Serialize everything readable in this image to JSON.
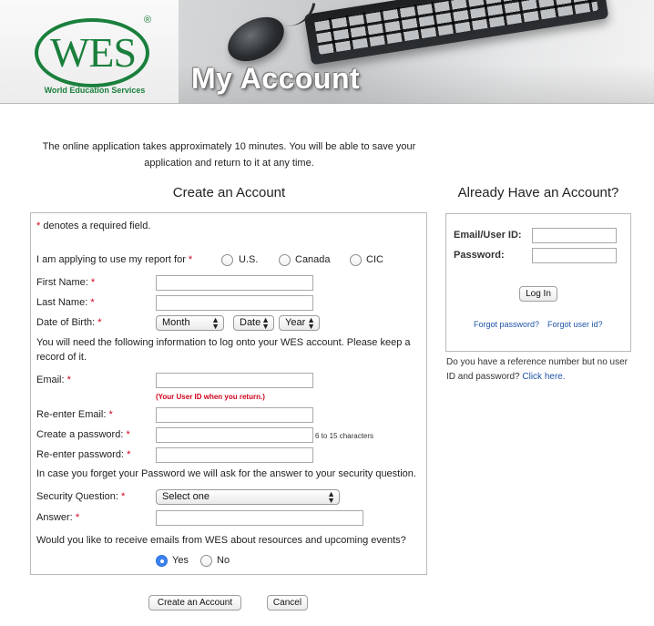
{
  "header": {
    "logo": {
      "mark": "WES",
      "registered": "®",
      "caption": "World Education Services"
    },
    "banner_title": "My Account"
  },
  "intro": {
    "line1": "The online application takes approximately 10 minutes. You will be able to save your",
    "line2": "application and return to it at any time."
  },
  "create_account": {
    "heading": "Create an Account",
    "required_note_star": "*",
    "required_note_text": " denotes a required field.",
    "report_for": {
      "label": "I am applying to use my report for",
      "options": [
        "U.S.",
        "Canada",
        "CIC"
      ],
      "selected": null
    },
    "first_name": {
      "label": "First Name:",
      "value": ""
    },
    "last_name": {
      "label": "Last Name:",
      "value": ""
    },
    "dob": {
      "label": "Date of Birth:",
      "month": "Month",
      "date": "Date",
      "year": "Year"
    },
    "logon_info_text": "You will need the following information to log onto your WES account. Please keep a record of it.",
    "email": {
      "label": "Email:",
      "value": "",
      "note": "(Your User ID when you return.)"
    },
    "reenter_email": {
      "label": "Re-enter Email:",
      "value": ""
    },
    "password": {
      "label": "Create a password:",
      "value": "",
      "hint": "6 to 15 characters"
    },
    "reenter_password": {
      "label": "Re-enter password:",
      "value": ""
    },
    "security_text": "In case you forget your Password we will ask for the answer to your security question.",
    "security_question": {
      "label": "Security Question:",
      "selected": "Select one"
    },
    "answer": {
      "label": "Answer:",
      "value": ""
    },
    "emails_question": "Would you like to receive emails from WES about resources and upcoming events?",
    "emails_options": {
      "yes": "Yes",
      "no": "No",
      "selected": "yes"
    },
    "required_star": "*",
    "submit_label": "Create an Account",
    "cancel_label": "Cancel"
  },
  "login": {
    "heading": "Already Have an Account?",
    "email_label": "Email/User ID:",
    "email_value": "",
    "password_label": "Password:",
    "password_value": "",
    "login_button": "Log In",
    "forgot_password": "Forgot password?",
    "forgot_userid": "Forgot user id?",
    "reference_text": "Do you have a reference number but no user ID and password?",
    "click_here": "Click here."
  },
  "colors": {
    "brand_green": "#1a7f3c",
    "required_red": "#d0021b",
    "link_blue": "#1f55a8",
    "radio_blue": "#3b82f0"
  },
  "icons": {
    "select_arrow": "updown-chevron-icon"
  }
}
